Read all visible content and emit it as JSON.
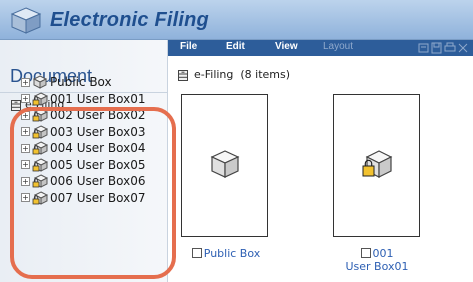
{
  "app": {
    "title": "Electronic Filing",
    "logo_icon": "cube-logo-icon"
  },
  "menubar": {
    "items": [
      {
        "label": "File",
        "enabled": true
      },
      {
        "label": "Edit",
        "enabled": true
      },
      {
        "label": "View",
        "enabled": true
      },
      {
        "label": "Layout",
        "enabled": false
      }
    ]
  },
  "sidebar": {
    "title": "Document",
    "root": {
      "label": "e-Filing",
      "icon": "cabinet-icon"
    },
    "boxes": [
      {
        "label": "Public Box",
        "icon": "box-icon",
        "locked": false
      },
      {
        "label": "001 User Box01",
        "icon": "locked-box-icon",
        "locked": true
      },
      {
        "label": "002 User Box02",
        "icon": "locked-box-icon",
        "locked": true
      },
      {
        "label": "003 User Box03",
        "icon": "locked-box-icon",
        "locked": true
      },
      {
        "label": "004 User Box04",
        "icon": "locked-box-icon",
        "locked": true
      },
      {
        "label": "005 User Box05",
        "icon": "locked-box-icon",
        "locked": true
      },
      {
        "label": "006 User Box06",
        "icon": "locked-box-icon",
        "locked": true
      },
      {
        "label": "007 User Box07",
        "icon": "locked-box-icon",
        "locked": true
      }
    ],
    "expander_symbol": "+"
  },
  "main": {
    "header": "e-Filing  (8 items)",
    "tiles": [
      {
        "caption_line1": "Public Box",
        "caption_line2": "",
        "icon": "box-icon"
      },
      {
        "caption_line1": "001",
        "caption_line2": "User Box01",
        "icon": "locked-box-icon"
      }
    ]
  },
  "colors": {
    "accent": "#2d5d9a",
    "title_text": "#1f4f8f",
    "link_text": "#2d5fb3",
    "highlight": "#e56e4e"
  }
}
